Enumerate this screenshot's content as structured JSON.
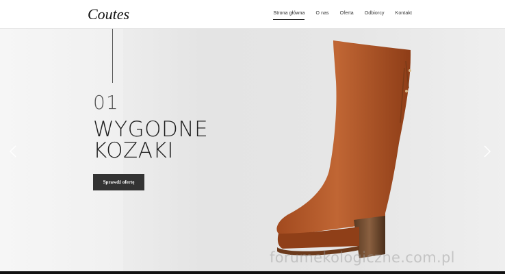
{
  "header": {
    "logo_text": "Coutes",
    "nav": [
      {
        "label": "Strona główna",
        "active": true
      },
      {
        "label": "O nas",
        "active": false
      },
      {
        "label": "Oferta",
        "active": false
      },
      {
        "label": "Odbiorcy",
        "active": false
      },
      {
        "label": "Kontakt",
        "active": false
      }
    ]
  },
  "hero": {
    "slide_number": "01",
    "title_line1": "WYGODNE",
    "title_line2": "KOZAKI",
    "cta_label": "Sprawdź ofertę",
    "prev_icon": "chevron-left-icon",
    "next_icon": "chevron-right-icon",
    "boot_color": "#b55a2a"
  },
  "watermark": "forumekologiczne.com.pl"
}
